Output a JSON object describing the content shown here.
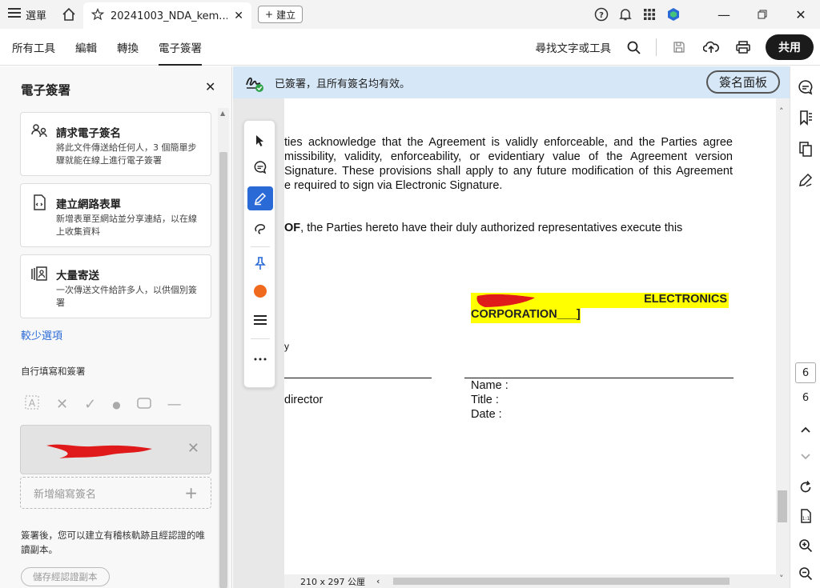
{
  "titlebar": {
    "menu_label": "選單",
    "tab_title": "20241003_NDA_kem...",
    "new_tab_label": "建立"
  },
  "menubar": {
    "items": [
      "所有工具",
      "編輯",
      "轉換",
      "電子簽署"
    ],
    "active_index": 3,
    "search_label": "尋找文字或工具",
    "share_label": "共用"
  },
  "leftpanel": {
    "title": "電子簽署",
    "cards": [
      {
        "icon": "request-signature-icon",
        "title": "請求電子簽名",
        "desc": "將此文件傳送給任何人，3 個簡單步驟就能在線上進行電子簽署"
      },
      {
        "icon": "web-form-icon",
        "title": "建立網路表單",
        "desc": "新增表單至網站並分享連結，以在線上收集資料"
      },
      {
        "icon": "bulk-send-icon",
        "title": "大量寄送",
        "desc": "一次傳送文件給許多人，以供個別簽署"
      }
    ],
    "fewer_options": "較少選項",
    "section_title": "自行填寫和簽署",
    "add_initials": "新增縮寫簽名",
    "note": "簽署後，您可以建立有稽核軌跡且經認證的唯讀副本。",
    "save_certified": "儲存經認證副本"
  },
  "banner": {
    "text": "已簽署，且所有簽名均有效。",
    "panel_button": "簽名面板"
  },
  "document": {
    "line1": "ties acknowledge that the Agreement is validly enforceable, and the Parties agree",
    "line2": "missibility, validity, enforceability, or evidentiary value of the Agreement version",
    "line3": "Signature. These provisions shall apply to any future modification of this Agreement",
    "line4": "e required to sign via Electronic Signature.",
    "witness_bold": "OF",
    "witness_rest": ", the Parties hereto have their duly authorized representatives execute this",
    "company_line1": "ELECTRONICS",
    "company_line2": "CORPORATION___]",
    "small_mark": "y",
    "left_director": "director",
    "name_label": "Name :",
    "title_label": "Title :",
    "date_label": "Date :"
  },
  "status": {
    "page_size": "210 x 297 公厘"
  },
  "rightrail": {
    "current_page": "6",
    "total_pages": "6"
  }
}
